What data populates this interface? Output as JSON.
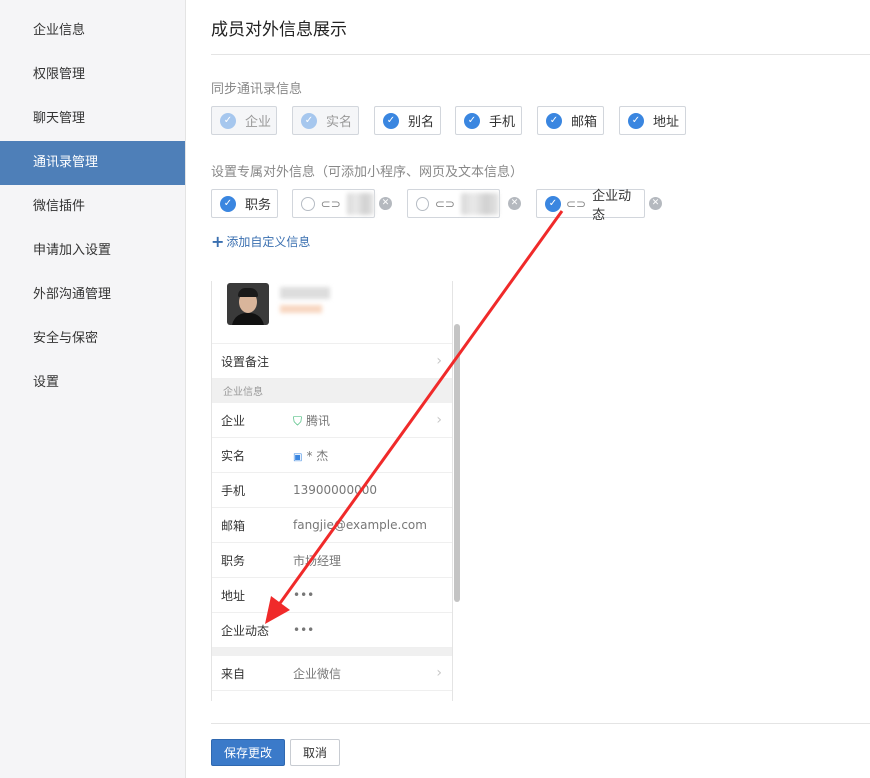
{
  "sidebar": {
    "items": [
      {
        "label": "企业信息"
      },
      {
        "label": "权限管理"
      },
      {
        "label": "聊天管理"
      },
      {
        "label": "通讯录管理"
      },
      {
        "label": "微信插件"
      },
      {
        "label": "申请加入设置"
      },
      {
        "label": "外部沟通管理"
      },
      {
        "label": "安全与保密"
      },
      {
        "label": "设置"
      }
    ],
    "active_index": 3
  },
  "page": {
    "title": "成员对外信息展示"
  },
  "sync": {
    "label": "同步通讯录信息",
    "chips": [
      {
        "label": "企业"
      },
      {
        "label": "实名"
      },
      {
        "label": "别名"
      },
      {
        "label": "手机"
      },
      {
        "label": "邮箱"
      },
      {
        "label": "地址"
      }
    ]
  },
  "custom": {
    "label": "设置专属对外信息（可添加小程序、网页及文本信息）",
    "chips": [
      {
        "label": "职务"
      },
      {
        "label": "企业动态"
      }
    ],
    "add_label": "添加自定义信息"
  },
  "preview": {
    "set_note": "设置备注",
    "group_title": "企业信息",
    "rows": [
      {
        "key": "企业",
        "value": "腾讯"
      },
      {
        "key": "实名",
        "value": "* 杰"
      },
      {
        "key": "手机",
        "value": "13900000000"
      },
      {
        "key": "邮箱",
        "value": "fangjie@example.com"
      },
      {
        "key": "职务",
        "value": "市场经理"
      },
      {
        "key": "地址",
        "value": "•••"
      },
      {
        "key": "企业动态",
        "value": "•••"
      }
    ],
    "from": {
      "key": "来自",
      "value": "企业微信"
    }
  },
  "actions": {
    "save": "保存更改",
    "cancel": "取消"
  },
  "colors": {
    "accent": "#3a86e0",
    "sidebar_active": "#4e7fb8",
    "arrow": "#f02a2a"
  }
}
